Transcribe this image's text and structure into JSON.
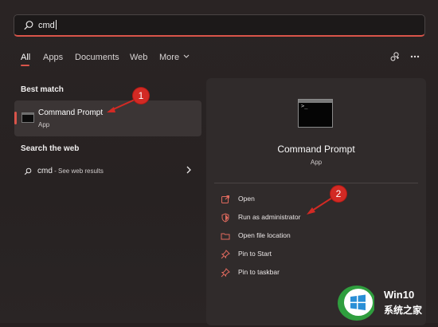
{
  "search": {
    "value": "cmd",
    "icon": "search-icon"
  },
  "tabs": [
    {
      "label": "All",
      "active": true
    },
    {
      "label": "Apps"
    },
    {
      "label": "Documents"
    },
    {
      "label": "Web"
    },
    {
      "label": "More"
    }
  ],
  "left": {
    "best_match_heading": "Best match",
    "best_match": {
      "title": "Command Prompt",
      "subtitle": "App"
    },
    "search_web_heading": "Search the web",
    "web_result": {
      "query": "cmd",
      "suffix": " - See web results"
    }
  },
  "right": {
    "title": "Command Prompt",
    "subtitle": "App",
    "actions": [
      {
        "label": "Open",
        "icon": "open-icon"
      },
      {
        "label": "Run as administrator",
        "icon": "shield-icon"
      },
      {
        "label": "Open file location",
        "icon": "folder-icon"
      },
      {
        "label": "Pin to Start",
        "icon": "pin-icon"
      },
      {
        "label": "Pin to taskbar",
        "icon": "pin-icon"
      }
    ]
  },
  "annotations": {
    "badge_1": "1",
    "badge_2": "2"
  },
  "watermark": {
    "line1": "Win10",
    "line2": "系统之家"
  },
  "colors": {
    "accent": "#d9544a",
    "annotation": "#d22a24"
  }
}
